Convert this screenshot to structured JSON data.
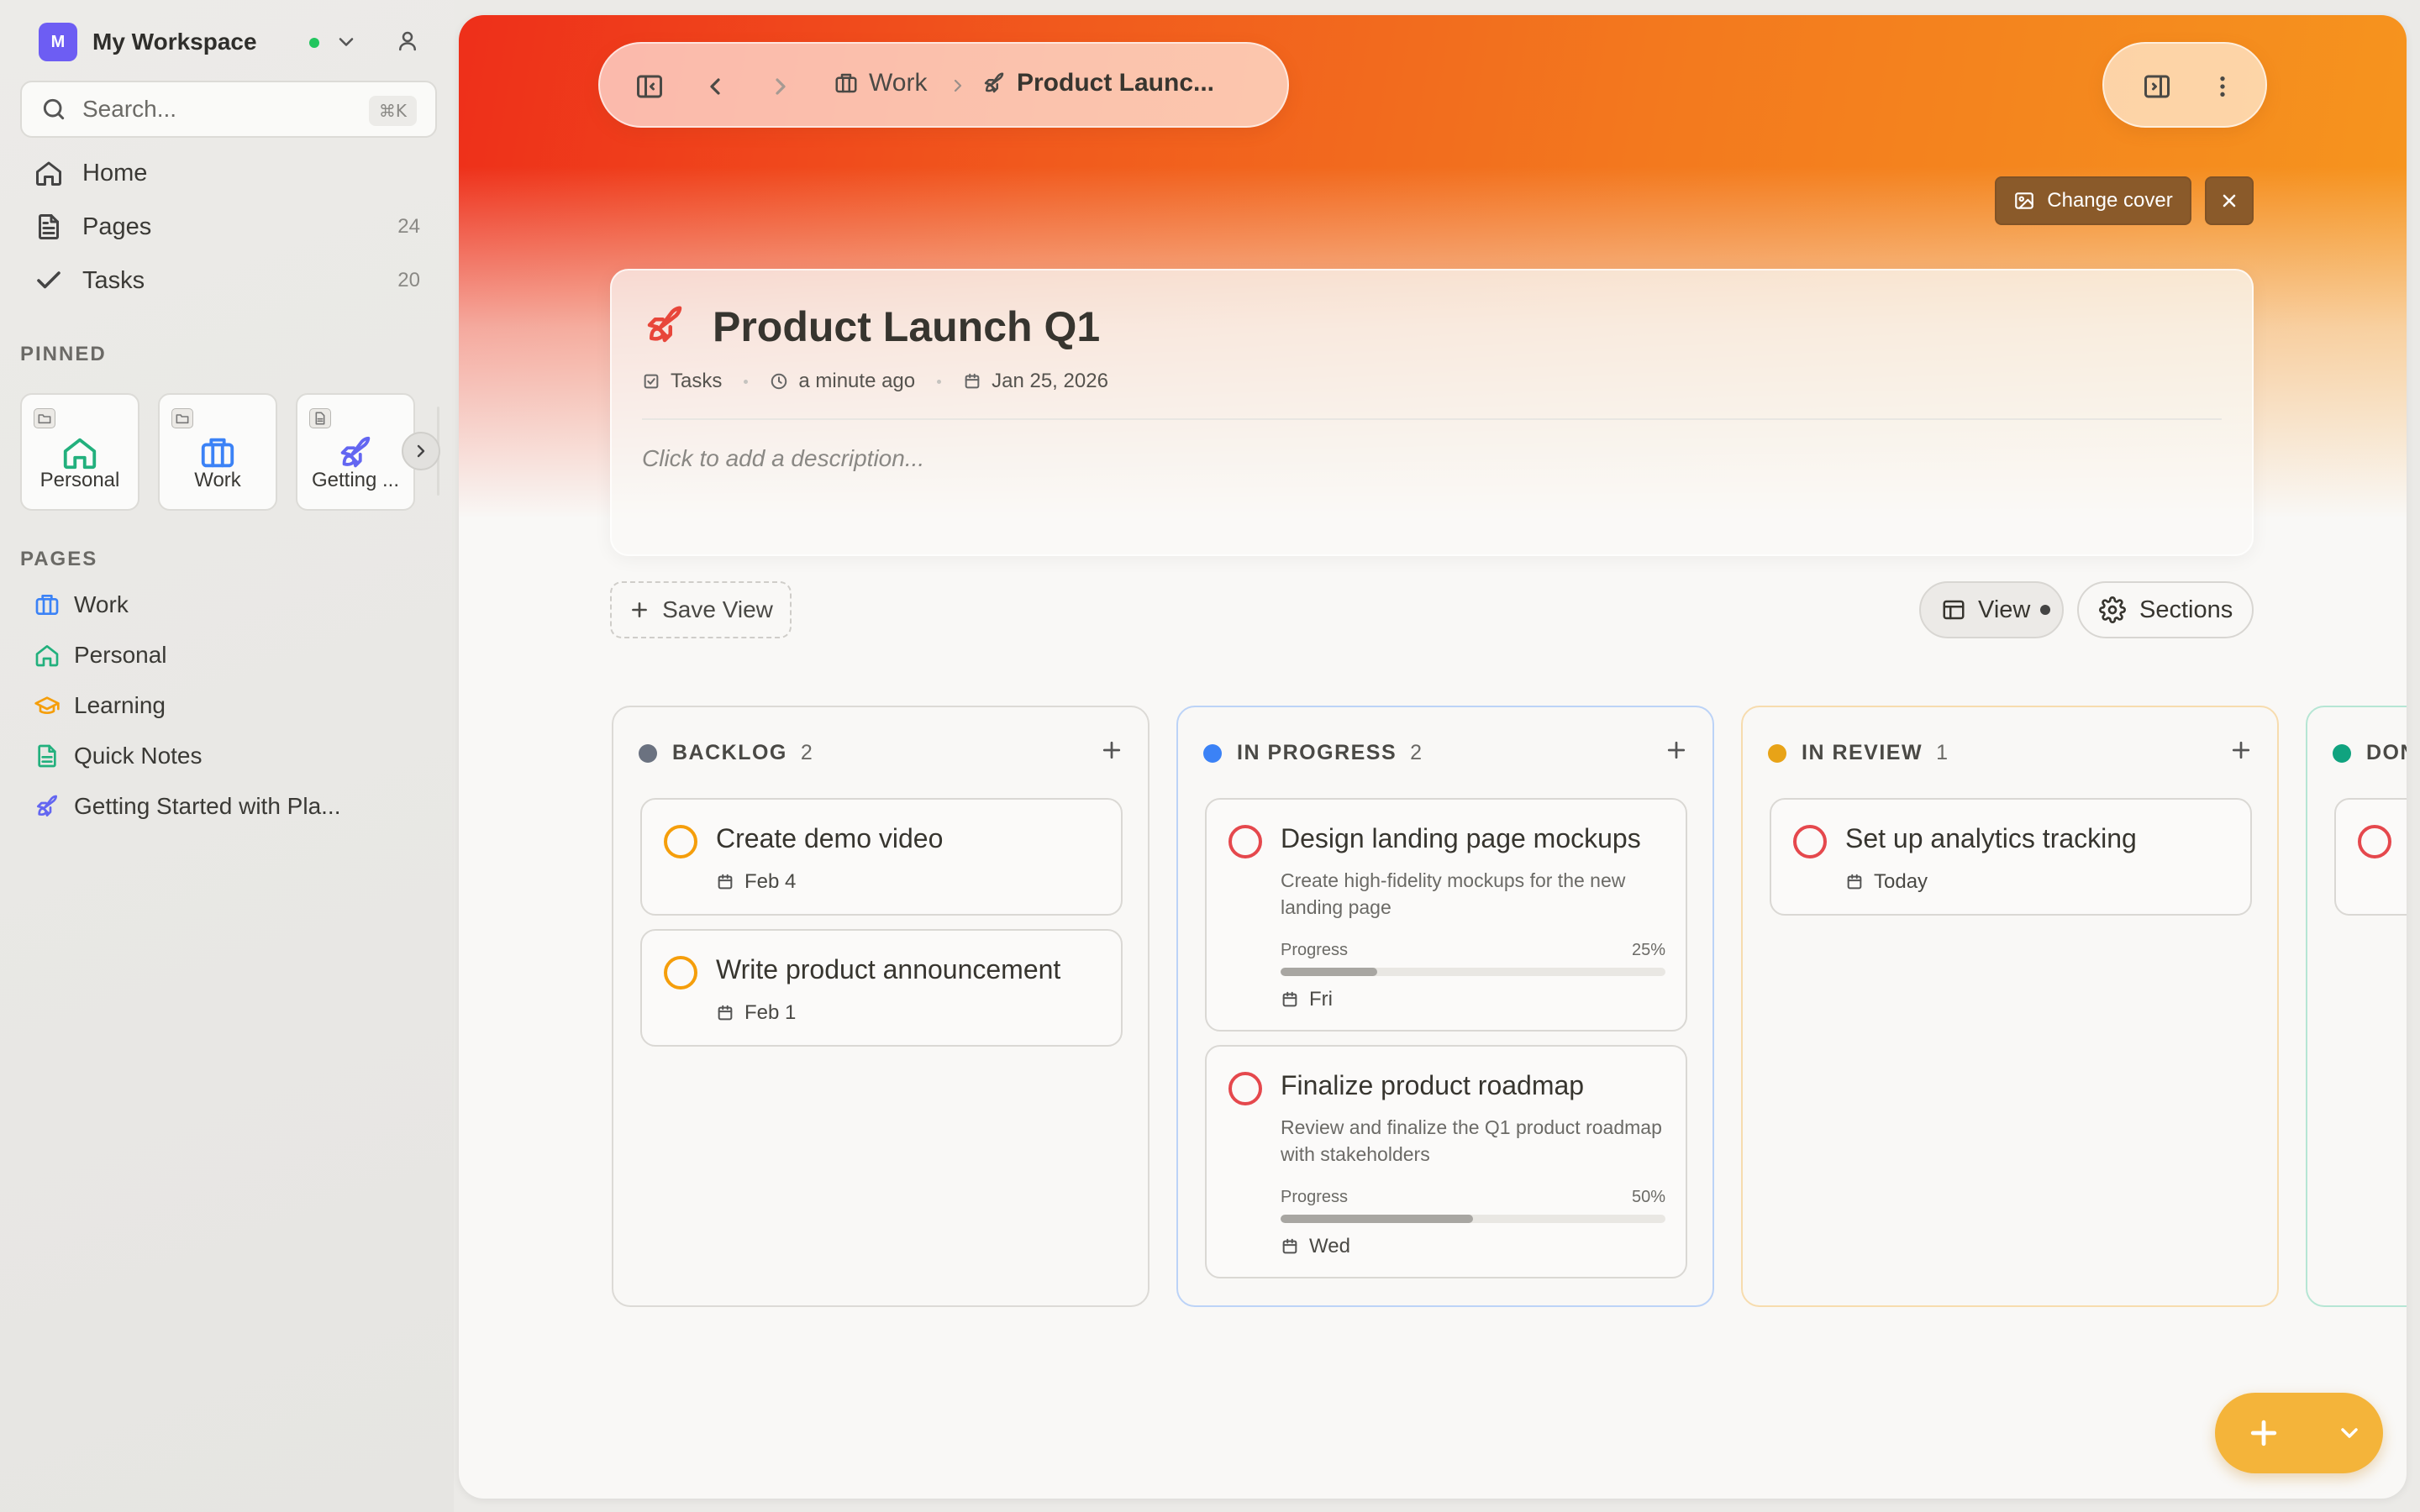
{
  "workspace": {
    "avatar_letter": "M",
    "name": "My Workspace",
    "status_color": "#22c55e"
  },
  "search": {
    "placeholder": "Search...",
    "shortcut": "⌘K"
  },
  "nav": [
    {
      "label": "Home",
      "count": "",
      "icon": "home-icon"
    },
    {
      "label": "Pages",
      "count": "24",
      "icon": "document-icon"
    },
    {
      "label": "Tasks",
      "count": "20",
      "icon": "check-icon"
    }
  ],
  "pinned": {
    "heading": "PINNED",
    "items": [
      {
        "label": "Personal",
        "icon": "home-icon",
        "color": "#22b07d"
      },
      {
        "label": "Work",
        "icon": "briefcase-icon",
        "color": "#3b82f6"
      },
      {
        "label": "Getting ...",
        "icon": "rocket-icon",
        "color": "#6366f1"
      }
    ]
  },
  "pages": {
    "heading": "PAGES",
    "items": [
      {
        "label": "Work",
        "icon": "briefcase-icon",
        "color": "#3b82f6"
      },
      {
        "label": "Personal",
        "icon": "home-icon",
        "color": "#22b07d"
      },
      {
        "label": "Learning",
        "icon": "graduation-cap-icon",
        "color": "#f59e0b"
      },
      {
        "label": "Quick Notes",
        "icon": "note-icon",
        "color": "#22b07d"
      },
      {
        "label": "Getting Started with Pla...",
        "icon": "rocket-icon",
        "color": "#6366f1"
      }
    ]
  },
  "breadcrumb": {
    "parent": "Work",
    "current": "Product Launc..."
  },
  "cover": {
    "change_label": "Change cover",
    "accent_color": "#f15a1d"
  },
  "page": {
    "title": "Product Launch Q1",
    "icon_color": "#e8463a",
    "meta_type": "Tasks",
    "meta_updated": "a minute ago",
    "meta_date": "Jan 25, 2026",
    "description_placeholder": "Click to add a description..."
  },
  "toolbar": {
    "save_view": "Save View",
    "view": "View",
    "sections": "Sections"
  },
  "board": {
    "columns": [
      {
        "name": "BACKLOG",
        "count": "2",
        "dot_color": "#6b7280",
        "border_color": "#dcdad6",
        "tasks": [
          {
            "title": "Create demo video",
            "date": "Feb 4",
            "check_color": "#f59e0b"
          },
          {
            "title": "Write product announcement",
            "date": "Feb 1",
            "check_color": "#f59e0b"
          }
        ]
      },
      {
        "name": "IN PROGRESS",
        "count": "2",
        "dot_color": "#3b82f6",
        "border_color": "#bcd3f7",
        "tasks": [
          {
            "title": "Design landing page mockups",
            "description": "Create high-fidelity mockups for the new landing page",
            "progress_label": "Progress",
            "progress": "25%",
            "progress_value": 0.25,
            "date": "Fri",
            "check_color": "#e5484d"
          },
          {
            "title": "Finalize product roadmap",
            "description": "Review and finalize the Q1 product roadmap with stakeholders",
            "progress_label": "Progress",
            "progress": "50%",
            "progress_value": 0.5,
            "date": "Wed",
            "check_color": "#e5484d"
          }
        ]
      },
      {
        "name": "IN REVIEW",
        "count": "1",
        "dot_color": "#e8a317",
        "border_color": "#f7dcae",
        "tasks": [
          {
            "title": "Set up analytics tracking",
            "date": "Today",
            "check_color": "#e5484d"
          }
        ]
      },
      {
        "name": "DONE",
        "count": "",
        "dot_color": "#10a37f",
        "border_color": "#b6e6d4",
        "tasks": [
          {
            "title": "",
            "date": "",
            "check_color": "#e5484d"
          }
        ]
      }
    ]
  }
}
